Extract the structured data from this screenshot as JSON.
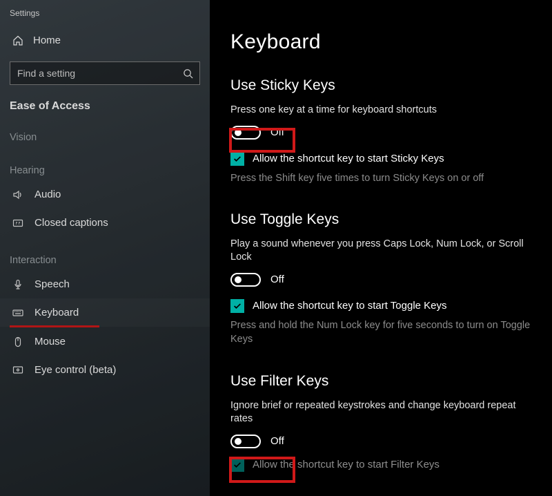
{
  "window_title": "Settings",
  "home_label": "Home",
  "search_placeholder": "Find a setting",
  "section_head": "Ease of Access",
  "groups": {
    "vision": "Vision",
    "hearing": "Hearing",
    "interaction": "Interaction"
  },
  "nav": {
    "audio": "Audio",
    "closed_captions": "Closed captions",
    "speech": "Speech",
    "keyboard": "Keyboard",
    "mouse": "Mouse",
    "eye_control": "Eye control (beta)"
  },
  "page_title": "Keyboard",
  "sticky": {
    "heading": "Use Sticky Keys",
    "desc": "Press one key at a time for keyboard shortcuts",
    "toggle_state": "Off",
    "check_label": "Allow the shortcut key to start Sticky Keys",
    "sub": "Press the Shift key five times to turn Sticky Keys on or off"
  },
  "toggle_keys": {
    "heading": "Use Toggle Keys",
    "desc": "Play a sound whenever you press Caps Lock, Num Lock, or Scroll Lock",
    "toggle_state": "Off",
    "check_label": "Allow the shortcut key to start Toggle Keys",
    "sub": "Press and hold the Num Lock key for five seconds to turn on Toggle Keys"
  },
  "filter": {
    "heading": "Use Filter Keys",
    "desc": "Ignore brief or repeated keystrokes and change keyboard repeat rates",
    "toggle_state": "Off",
    "check_label": "Allow the shortcut key to start Filter Keys"
  },
  "colors": {
    "accent": "#00b0a5",
    "highlight": "#d01919"
  }
}
